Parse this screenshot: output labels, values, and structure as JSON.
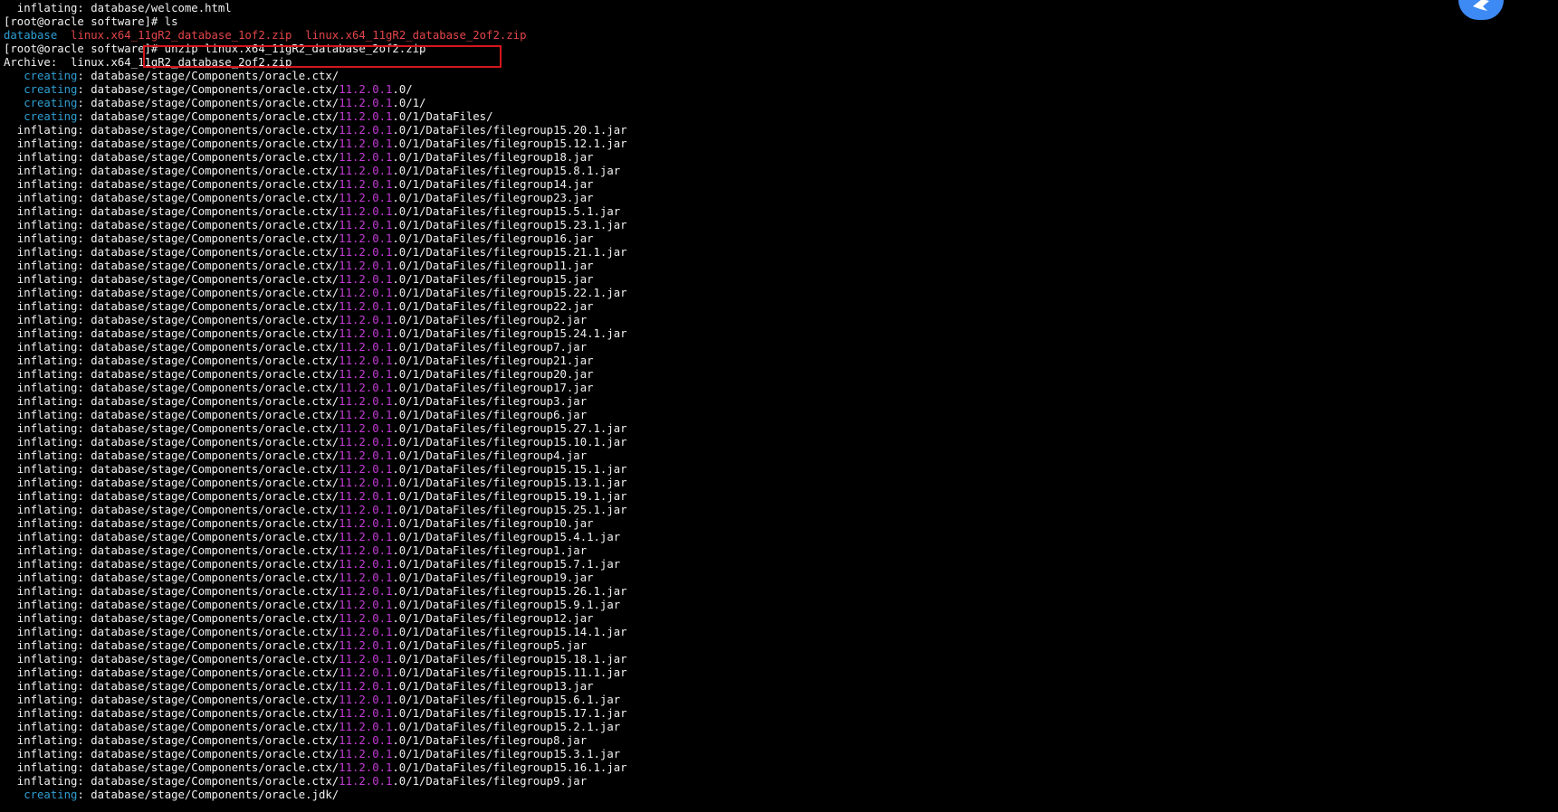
{
  "terminal": {
    "lines": [
      [
        {
          "t": "  inflating: database/welcome.html"
        }
      ],
      [
        {
          "t": "[root@oracle software]# ls"
        }
      ],
      [
        {
          "t": "database",
          "c": "blue"
        },
        {
          "t": "  "
        },
        {
          "t": "linux.x64_11gR2_database_1of2.zip",
          "c": "red"
        },
        {
          "t": "  "
        },
        {
          "t": "linux.x64_11gR2_database_2of2.zip",
          "c": "red"
        }
      ],
      [
        {
          "t": "[root@oracle software]# unzip linux.x64_11gR2_database_2of2.zip"
        }
      ],
      [
        {
          "t": "Archive:  linux.x64_11gR2_database_2of2.zip"
        }
      ],
      [
        {
          "t": "   "
        },
        {
          "t": "creating",
          "c": "blue"
        },
        {
          "t": ": database/stage/Components/oracle.ctx/"
        }
      ],
      [
        {
          "t": "   "
        },
        {
          "t": "creating",
          "c": "blue"
        },
        {
          "t": ": database/stage/Components/oracle.ctx/"
        },
        {
          "t": "11.2.0.1",
          "c": "mag"
        },
        {
          "t": ".0/"
        }
      ],
      [
        {
          "t": "   "
        },
        {
          "t": "creating",
          "c": "blue"
        },
        {
          "t": ": database/stage/Components/oracle.ctx/"
        },
        {
          "t": "11.2.0.1",
          "c": "mag"
        },
        {
          "t": ".0/1/"
        }
      ],
      [
        {
          "t": "   "
        },
        {
          "t": "creating",
          "c": "blue"
        },
        {
          "t": ": database/stage/Components/oracle.ctx/"
        },
        {
          "t": "11.2.0.1",
          "c": "mag"
        },
        {
          "t": ".0/1/DataFiles/"
        }
      ],
      [
        {
          "t": "  inflating: database/stage/Components/oracle.ctx/"
        },
        {
          "t": "11.2.0.1",
          "c": "mag"
        },
        {
          "t": ".0/1/DataFiles/filegroup15.20.1.jar"
        }
      ],
      [
        {
          "t": "  inflating: database/stage/Components/oracle.ctx/"
        },
        {
          "t": "11.2.0.1",
          "c": "mag"
        },
        {
          "t": ".0/1/DataFiles/filegroup15.12.1.jar"
        }
      ],
      [
        {
          "t": "  inflating: database/stage/Components/oracle.ctx/"
        },
        {
          "t": "11.2.0.1",
          "c": "mag"
        },
        {
          "t": ".0/1/DataFiles/filegroup18.jar"
        }
      ],
      [
        {
          "t": "  inflating: database/stage/Components/oracle.ctx/"
        },
        {
          "t": "11.2.0.1",
          "c": "mag"
        },
        {
          "t": ".0/1/DataFiles/filegroup15.8.1.jar"
        }
      ],
      [
        {
          "t": "  inflating: database/stage/Components/oracle.ctx/"
        },
        {
          "t": "11.2.0.1",
          "c": "mag"
        },
        {
          "t": ".0/1/DataFiles/filegroup14.jar"
        }
      ],
      [
        {
          "t": "  inflating: database/stage/Components/oracle.ctx/"
        },
        {
          "t": "11.2.0.1",
          "c": "mag"
        },
        {
          "t": ".0/1/DataFiles/filegroup23.jar"
        }
      ],
      [
        {
          "t": "  inflating: database/stage/Components/oracle.ctx/"
        },
        {
          "t": "11.2.0.1",
          "c": "mag"
        },
        {
          "t": ".0/1/DataFiles/filegroup15.5.1.jar"
        }
      ],
      [
        {
          "t": "  inflating: database/stage/Components/oracle.ctx/"
        },
        {
          "t": "11.2.0.1",
          "c": "mag"
        },
        {
          "t": ".0/1/DataFiles/filegroup15.23.1.jar"
        }
      ],
      [
        {
          "t": "  inflating: database/stage/Components/oracle.ctx/"
        },
        {
          "t": "11.2.0.1",
          "c": "mag"
        },
        {
          "t": ".0/1/DataFiles/filegroup16.jar"
        }
      ],
      [
        {
          "t": "  inflating: database/stage/Components/oracle.ctx/"
        },
        {
          "t": "11.2.0.1",
          "c": "mag"
        },
        {
          "t": ".0/1/DataFiles/filegroup15.21.1.jar"
        }
      ],
      [
        {
          "t": "  inflating: database/stage/Components/oracle.ctx/"
        },
        {
          "t": "11.2.0.1",
          "c": "mag"
        },
        {
          "t": ".0/1/DataFiles/filegroup11.jar"
        }
      ],
      [
        {
          "t": "  inflating: database/stage/Components/oracle.ctx/"
        },
        {
          "t": "11.2.0.1",
          "c": "mag"
        },
        {
          "t": ".0/1/DataFiles/filegroup15.jar"
        }
      ],
      [
        {
          "t": "  inflating: database/stage/Components/oracle.ctx/"
        },
        {
          "t": "11.2.0.1",
          "c": "mag"
        },
        {
          "t": ".0/1/DataFiles/filegroup15.22.1.jar"
        }
      ],
      [
        {
          "t": "  inflating: database/stage/Components/oracle.ctx/"
        },
        {
          "t": "11.2.0.1",
          "c": "mag"
        },
        {
          "t": ".0/1/DataFiles/filegroup22.jar"
        }
      ],
      [
        {
          "t": "  inflating: database/stage/Components/oracle.ctx/"
        },
        {
          "t": "11.2.0.1",
          "c": "mag"
        },
        {
          "t": ".0/1/DataFiles/filegroup2.jar"
        }
      ],
      [
        {
          "t": "  inflating: database/stage/Components/oracle.ctx/"
        },
        {
          "t": "11.2.0.1",
          "c": "mag"
        },
        {
          "t": ".0/1/DataFiles/filegroup15.24.1.jar"
        }
      ],
      [
        {
          "t": "  inflating: database/stage/Components/oracle.ctx/"
        },
        {
          "t": "11.2.0.1",
          "c": "mag"
        },
        {
          "t": ".0/1/DataFiles/filegroup7.jar"
        }
      ],
      [
        {
          "t": "  inflating: database/stage/Components/oracle.ctx/"
        },
        {
          "t": "11.2.0.1",
          "c": "mag"
        },
        {
          "t": ".0/1/DataFiles/filegroup21.jar"
        }
      ],
      [
        {
          "t": "  inflating: database/stage/Components/oracle.ctx/"
        },
        {
          "t": "11.2.0.1",
          "c": "mag"
        },
        {
          "t": ".0/1/DataFiles/filegroup20.jar"
        }
      ],
      [
        {
          "t": "  inflating: database/stage/Components/oracle.ctx/"
        },
        {
          "t": "11.2.0.1",
          "c": "mag"
        },
        {
          "t": ".0/1/DataFiles/filegroup17.jar"
        }
      ],
      [
        {
          "t": "  inflating: database/stage/Components/oracle.ctx/"
        },
        {
          "t": "11.2.0.1",
          "c": "mag"
        },
        {
          "t": ".0/1/DataFiles/filegroup3.jar"
        }
      ],
      [
        {
          "t": "  inflating: database/stage/Components/oracle.ctx/"
        },
        {
          "t": "11.2.0.1",
          "c": "mag"
        },
        {
          "t": ".0/1/DataFiles/filegroup6.jar"
        }
      ],
      [
        {
          "t": "  inflating: database/stage/Components/oracle.ctx/"
        },
        {
          "t": "11.2.0.1",
          "c": "mag"
        },
        {
          "t": ".0/1/DataFiles/filegroup15.27.1.jar"
        }
      ],
      [
        {
          "t": "  inflating: database/stage/Components/oracle.ctx/"
        },
        {
          "t": "11.2.0.1",
          "c": "mag"
        },
        {
          "t": ".0/1/DataFiles/filegroup15.10.1.jar"
        }
      ],
      [
        {
          "t": "  inflating: database/stage/Components/oracle.ctx/"
        },
        {
          "t": "11.2.0.1",
          "c": "mag"
        },
        {
          "t": ".0/1/DataFiles/filegroup4.jar"
        }
      ],
      [
        {
          "t": "  inflating: database/stage/Components/oracle.ctx/"
        },
        {
          "t": "11.2.0.1",
          "c": "mag"
        },
        {
          "t": ".0/1/DataFiles/filegroup15.15.1.jar"
        }
      ],
      [
        {
          "t": "  inflating: database/stage/Components/oracle.ctx/"
        },
        {
          "t": "11.2.0.1",
          "c": "mag"
        },
        {
          "t": ".0/1/DataFiles/filegroup15.13.1.jar"
        }
      ],
      [
        {
          "t": "  inflating: database/stage/Components/oracle.ctx/"
        },
        {
          "t": "11.2.0.1",
          "c": "mag"
        },
        {
          "t": ".0/1/DataFiles/filegroup15.19.1.jar"
        }
      ],
      [
        {
          "t": "  inflating: database/stage/Components/oracle.ctx/"
        },
        {
          "t": "11.2.0.1",
          "c": "mag"
        },
        {
          "t": ".0/1/DataFiles/filegroup15.25.1.jar"
        }
      ],
      [
        {
          "t": "  inflating: database/stage/Components/oracle.ctx/"
        },
        {
          "t": "11.2.0.1",
          "c": "mag"
        },
        {
          "t": ".0/1/DataFiles/filegroup10.jar"
        }
      ],
      [
        {
          "t": "  inflating: database/stage/Components/oracle.ctx/"
        },
        {
          "t": "11.2.0.1",
          "c": "mag"
        },
        {
          "t": ".0/1/DataFiles/filegroup15.4.1.jar"
        }
      ],
      [
        {
          "t": "  inflating: database/stage/Components/oracle.ctx/"
        },
        {
          "t": "11.2.0.1",
          "c": "mag"
        },
        {
          "t": ".0/1/DataFiles/filegroup1.jar"
        }
      ],
      [
        {
          "t": "  inflating: database/stage/Components/oracle.ctx/"
        },
        {
          "t": "11.2.0.1",
          "c": "mag"
        },
        {
          "t": ".0/1/DataFiles/filegroup15.7.1.jar"
        }
      ],
      [
        {
          "t": "  inflating: database/stage/Components/oracle.ctx/"
        },
        {
          "t": "11.2.0.1",
          "c": "mag"
        },
        {
          "t": ".0/1/DataFiles/filegroup19.jar"
        }
      ],
      [
        {
          "t": "  inflating: database/stage/Components/oracle.ctx/"
        },
        {
          "t": "11.2.0.1",
          "c": "mag"
        },
        {
          "t": ".0/1/DataFiles/filegroup15.26.1.jar"
        }
      ],
      [
        {
          "t": "  inflating: database/stage/Components/oracle.ctx/"
        },
        {
          "t": "11.2.0.1",
          "c": "mag"
        },
        {
          "t": ".0/1/DataFiles/filegroup15.9.1.jar"
        }
      ],
      [
        {
          "t": "  inflating: database/stage/Components/oracle.ctx/"
        },
        {
          "t": "11.2.0.1",
          "c": "mag"
        },
        {
          "t": ".0/1/DataFiles/filegroup12.jar"
        }
      ],
      [
        {
          "t": "  inflating: database/stage/Components/oracle.ctx/"
        },
        {
          "t": "11.2.0.1",
          "c": "mag"
        },
        {
          "t": ".0/1/DataFiles/filegroup15.14.1.jar"
        }
      ],
      [
        {
          "t": "  inflating: database/stage/Components/oracle.ctx/"
        },
        {
          "t": "11.2.0.1",
          "c": "mag"
        },
        {
          "t": ".0/1/DataFiles/filegroup5.jar"
        }
      ],
      [
        {
          "t": "  inflating: database/stage/Components/oracle.ctx/"
        },
        {
          "t": "11.2.0.1",
          "c": "mag"
        },
        {
          "t": ".0/1/DataFiles/filegroup15.18.1.jar"
        }
      ],
      [
        {
          "t": "  inflating: database/stage/Components/oracle.ctx/"
        },
        {
          "t": "11.2.0.1",
          "c": "mag"
        },
        {
          "t": ".0/1/DataFiles/filegroup15.11.1.jar"
        }
      ],
      [
        {
          "t": "  inflating: database/stage/Components/oracle.ctx/"
        },
        {
          "t": "11.2.0.1",
          "c": "mag"
        },
        {
          "t": ".0/1/DataFiles/filegroup13.jar"
        }
      ],
      [
        {
          "t": "  inflating: database/stage/Components/oracle.ctx/"
        },
        {
          "t": "11.2.0.1",
          "c": "mag"
        },
        {
          "t": ".0/1/DataFiles/filegroup15.6.1.jar"
        }
      ],
      [
        {
          "t": "  inflating: database/stage/Components/oracle.ctx/"
        },
        {
          "t": "11.2.0.1",
          "c": "mag"
        },
        {
          "t": ".0/1/DataFiles/filegroup15.17.1.jar"
        }
      ],
      [
        {
          "t": "  inflating: database/stage/Components/oracle.ctx/"
        },
        {
          "t": "11.2.0.1",
          "c": "mag"
        },
        {
          "t": ".0/1/DataFiles/filegroup15.2.1.jar"
        }
      ],
      [
        {
          "t": "  inflating: database/stage/Components/oracle.ctx/"
        },
        {
          "t": "11.2.0.1",
          "c": "mag"
        },
        {
          "t": ".0/1/DataFiles/filegroup8.jar"
        }
      ],
      [
        {
          "t": "  inflating: database/stage/Components/oracle.ctx/"
        },
        {
          "t": "11.2.0.1",
          "c": "mag"
        },
        {
          "t": ".0/1/DataFiles/filegroup15.3.1.jar"
        }
      ],
      [
        {
          "t": "  inflating: database/stage/Components/oracle.ctx/"
        },
        {
          "t": "11.2.0.1",
          "c": "mag"
        },
        {
          "t": ".0/1/DataFiles/filegroup15.16.1.jar"
        }
      ],
      [
        {
          "t": "  inflating: database/stage/Components/oracle.ctx/"
        },
        {
          "t": "11.2.0.1",
          "c": "mag"
        },
        {
          "t": ".0/1/DataFiles/filegroup9.jar"
        }
      ],
      [
        {
          "t": "   "
        },
        {
          "t": "creating",
          "c": "blue"
        },
        {
          "t": ": database/stage/Components/oracle.jdk/"
        }
      ]
    ]
  },
  "colors": {
    "background": "#000000",
    "text": "#f2f2f2",
    "blue": "#2f9fd3",
    "red": "#e2454a",
    "magenta": "#c43bd6",
    "highlight_box": "#d4161c",
    "tray_icon": "#3d8af5"
  },
  "icons": {
    "tray": "feather-logo-icon"
  }
}
